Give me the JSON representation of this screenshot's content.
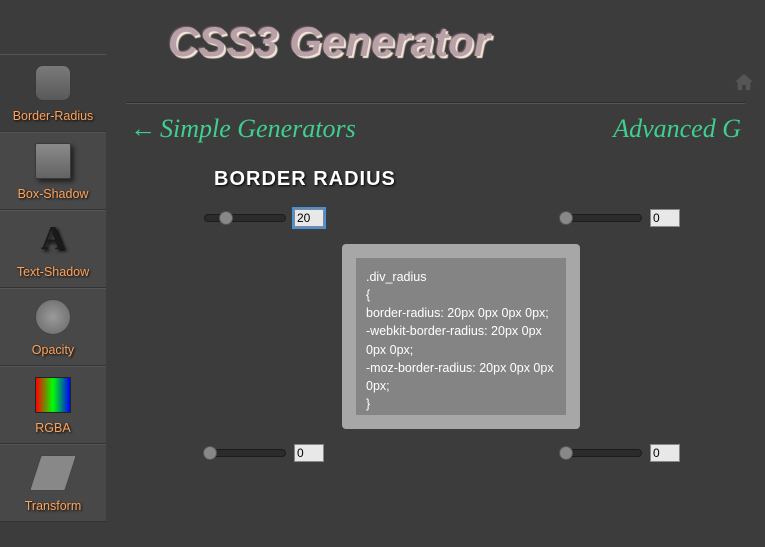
{
  "title": "CSS3 Generator",
  "nav": {
    "prev": "Simple Generators",
    "next": "Advanced G"
  },
  "sidebar": {
    "items": [
      {
        "label": "Border-Radius"
      },
      {
        "label": "Box-Shadow"
      },
      {
        "label": "Text-Shadow"
      },
      {
        "label": "Opacity"
      },
      {
        "label": "RGBA"
      },
      {
        "label": "Transform"
      }
    ]
  },
  "section": {
    "title": "BORDER RADIUS"
  },
  "sliders": {
    "tl": "20",
    "tr": "0",
    "bl": "0",
    "br": "0"
  },
  "code": {
    "selector": ".div_radius",
    "text": ".div_radius\n{\nborder-radius: 20px 0px 0px 0px;\n-webkit-border-radius: 20px 0px 0px 0px;\n-moz-border-radius: 20px 0px 0px 0px;\n}"
  }
}
